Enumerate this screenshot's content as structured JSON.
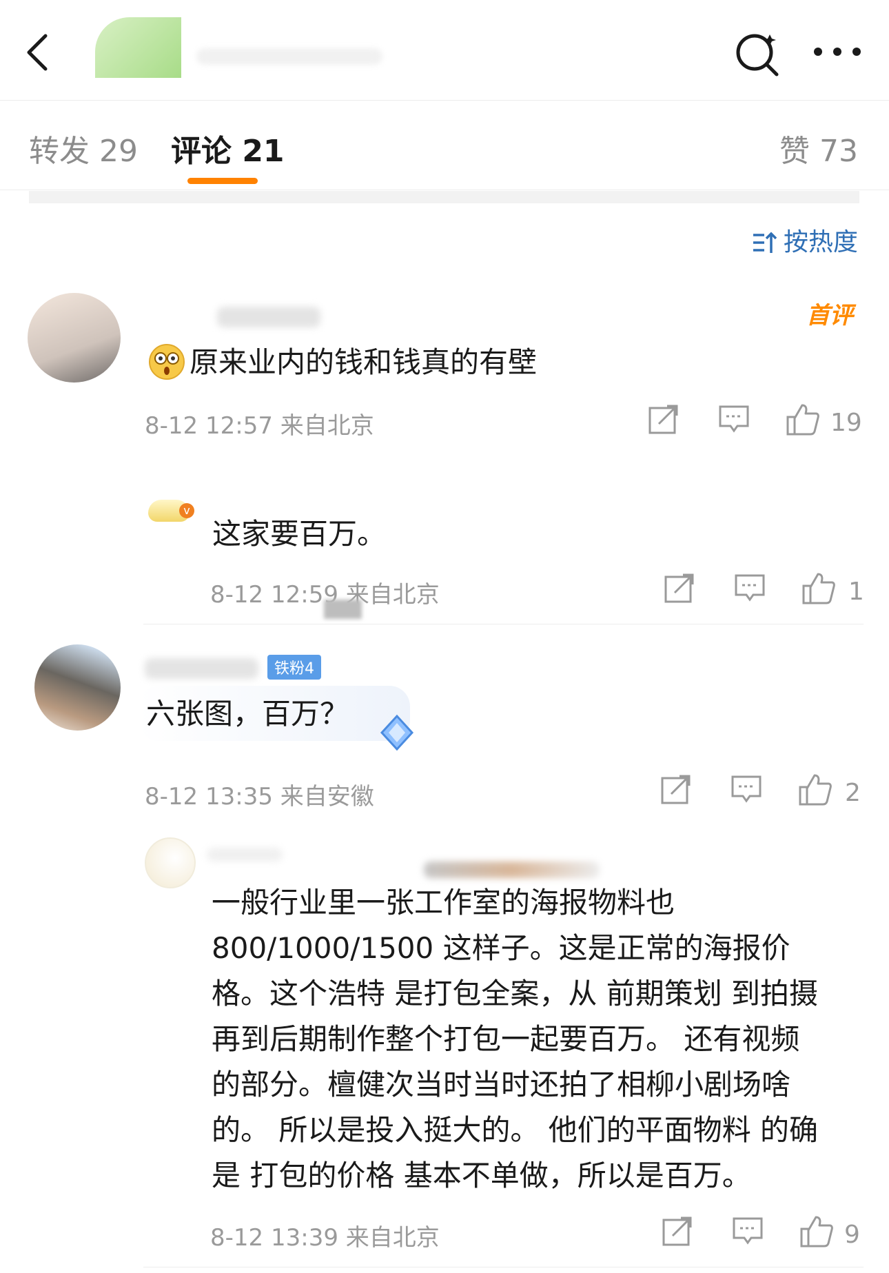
{
  "header": {
    "back_icon": "chevron-left-icon",
    "search_icon": "search-icon",
    "more_icon": "more-icon"
  },
  "tabs": [
    {
      "label": "转发 29"
    },
    {
      "label": "评论 21"
    },
    {
      "label": "赞 73"
    }
  ],
  "sort_label": "按热度",
  "colors": {
    "accent": "#ff8200",
    "link": "#2f6fb5",
    "meta": "#9a9a9a"
  },
  "comments": [
    {
      "badge": "首评",
      "text": "原来业内的钱和钱真的有壁",
      "time": "8-12 12:57",
      "location": "来自北京",
      "likes": "19"
    },
    {
      "text": "这家要百万。",
      "time": "8-12 12:59",
      "location": "来自北京",
      "likes": "1"
    },
    {
      "fan_badge": "铁粉4",
      "text": "六张图，百万？",
      "time": "8-12 13:35",
      "location": "来自安徽",
      "likes": "2"
    },
    {
      "lines": [
        "一般行业里一张工作室的海报物料也",
        "800/1000/1500 这样子。这是正常的海报价",
        "格。这个浩特 是打包全案，从 前期策划 到拍摄",
        "再到后期制作整个打包一起要百万。 还有视频",
        "的部分。檀健次当时当时还拍了相柳小剧场啥",
        "的。 所以是投入挺大的。 他们的平面物料 的确",
        "是 打包的价格 基本不单做，所以是百万。"
      ],
      "time": "8-12 13:39",
      "location": "来自北京",
      "likes": "9"
    }
  ]
}
